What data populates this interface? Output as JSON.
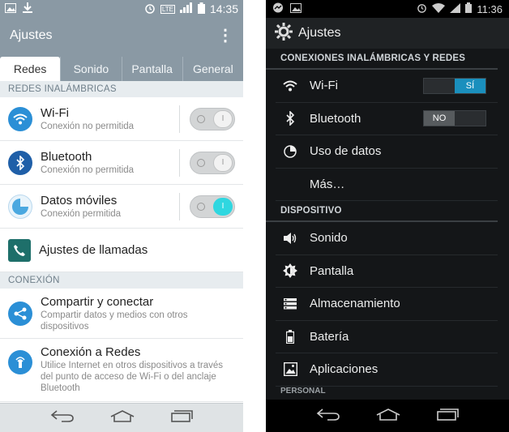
{
  "colors": {
    "lg_header": "#8a99a4",
    "lg_toggle_on": "#2fd7e0",
    "ak_switch_on": "#1a8fbd",
    "ak_background": "#141618"
  },
  "left": {
    "status": {
      "time": "14:35",
      "lte": "LTE"
    },
    "title": "Ajustes",
    "tabs": [
      {
        "label": "Redes",
        "active": true
      },
      {
        "label": "Sonido",
        "active": false
      },
      {
        "label": "Pantalla",
        "active": false
      },
      {
        "label": "General",
        "active": false
      }
    ],
    "sections": {
      "wireless": "REDES INALÁMBRICAS",
      "connection": "CONEXIÓN"
    },
    "rows": [
      {
        "title": "Wi-Fi",
        "subtitle": "Conexión no permitida",
        "icon": "wifi-icon",
        "toggle": "off"
      },
      {
        "title": "Bluetooth",
        "subtitle": "Conexión no permitida",
        "icon": "bluetooth-icon",
        "toggle": "off"
      },
      {
        "title": "Datos móviles",
        "subtitle": "Conexión permitida",
        "icon": "mobile-data-icon",
        "toggle": "on"
      },
      {
        "title": "Ajustes de llamadas",
        "icon": "phone-icon"
      }
    ],
    "connection_rows": [
      {
        "title": "Compartir y conectar",
        "subtitle": "Compartir datos y medios con otros dispositivos",
        "icon": "share-icon"
      },
      {
        "title": "Conexión a Redes",
        "subtitle": "Utilice Internet en otros dispositivos a través del punto de acceso de Wi-Fi o del anclaje Bluetooth",
        "icon": "tethering-icon"
      }
    ]
  },
  "right": {
    "status": {
      "time": "11:36"
    },
    "title": "Ajustes",
    "sections": {
      "wireless": "CONEXIONES INALÁMBRICAS Y REDES",
      "device": "DISPOSITIVO",
      "personal": "PERSONAL"
    },
    "wireless_rows": [
      {
        "label": "Wi-Fi",
        "icon": "wifi-icon",
        "switch": "SÍ"
      },
      {
        "label": "Bluetooth",
        "icon": "bluetooth-icon",
        "switch": "NO"
      },
      {
        "label": "Uso de datos",
        "icon": "data-usage-icon"
      },
      {
        "label": "Más…"
      }
    ],
    "device_rows": [
      {
        "label": "Sonido",
        "icon": "volume-icon"
      },
      {
        "label": "Pantalla",
        "icon": "brightness-icon"
      },
      {
        "label": "Almacenamiento",
        "icon": "storage-icon"
      },
      {
        "label": "Batería",
        "icon": "battery-icon"
      },
      {
        "label": "Aplicaciones",
        "icon": "apps-icon"
      }
    ]
  }
}
